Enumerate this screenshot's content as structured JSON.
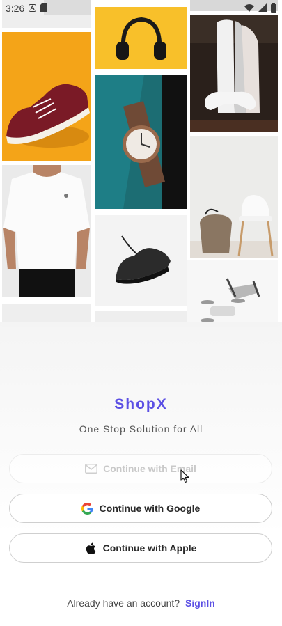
{
  "status_bar": {
    "time": "3:26",
    "icons": [
      "a-icon",
      "sim-card-icon",
      "wifi-icon",
      "signal-icon",
      "battery-icon"
    ]
  },
  "gallery": {
    "images": [
      {
        "name": "sneaker-maroon",
        "bg": "#f4a418"
      },
      {
        "name": "headphones",
        "bg": "#f8c02a"
      },
      {
        "name": "playstation-console",
        "bg": "#2a201b"
      },
      {
        "name": "wristwatch",
        "bg": "#1c6d73"
      },
      {
        "name": "white-tshirt",
        "bg": "#e9e9e9"
      },
      {
        "name": "white-chair",
        "bg": "#ececea"
      },
      {
        "name": "black-sneaker",
        "bg": "#f3f3f3"
      },
      {
        "name": "drone",
        "bg": "#f7f7f7"
      }
    ]
  },
  "brand": {
    "name": "ShopX",
    "tagline": "One Stop Solution for All",
    "accent_color": "#5b4fe4"
  },
  "auth": {
    "email_label": "Continue with Email",
    "google_label": "Continue with Google",
    "apple_label": "Continue with Apple"
  },
  "footer": {
    "prompt": "Already have an account?",
    "signin_label": "SignIn"
  }
}
